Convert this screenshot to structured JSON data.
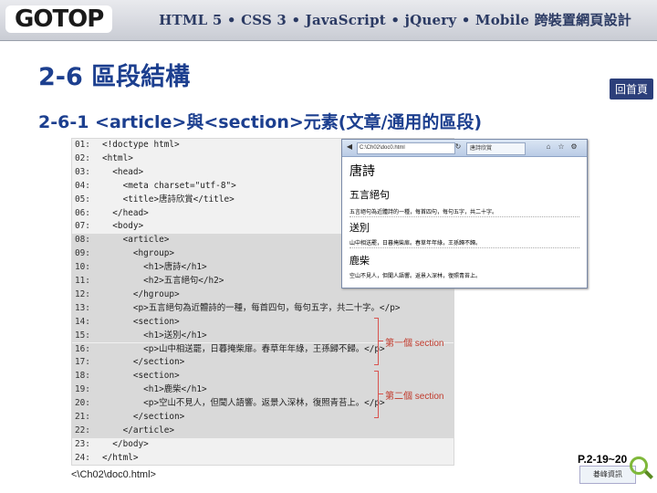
{
  "header": {
    "logo": "GOTOP",
    "title": "HTML 5 • CSS 3 • JavaScript • jQuery • Mobile 跨裝置網頁設計"
  },
  "page_title": "2-6  區段結構",
  "home_button": "回首頁",
  "subtitle": "2-6-1 <article>與<section>元素(文章/通用的區段)",
  "code_lines": [
    {
      "num": "01:",
      "code": "<!doctype html>"
    },
    {
      "num": "02:",
      "code": "<html>"
    },
    {
      "num": "03:",
      "code": "  <head>"
    },
    {
      "num": "04:",
      "code": "    <meta charset=\"utf-8\">"
    },
    {
      "num": "05:",
      "code": "    <title>唐詩欣賞</title>"
    },
    {
      "num": "06:",
      "code": "  </head>"
    },
    {
      "num": "07:",
      "code": "  <body>"
    },
    {
      "num": "08:",
      "code": "    <article>"
    },
    {
      "num": "09:",
      "code": "      <hgroup>"
    },
    {
      "num": "10:",
      "code": "        <h1>唐詩</h1>"
    },
    {
      "num": "11:",
      "code": "        <h2>五言絕句</h2>"
    },
    {
      "num": "12:",
      "code": "      </hgroup>"
    },
    {
      "num": "13:",
      "code": "      <p>五言絕句為近體詩的一種，每首四句，每句五字，共二十字。</p>"
    },
    {
      "num": "14:",
      "code": "      <section>"
    },
    {
      "num": "15:",
      "code": "        <h1>送別</h1>"
    },
    {
      "num": "16:",
      "code": "        <p>山中相送罷，日暮掩柴扉。春草年年綠，王孫歸不歸。</p>"
    },
    {
      "num": "17:",
      "code": "      </section>"
    },
    {
      "num": "18:",
      "code": "      <section>"
    },
    {
      "num": "19:",
      "code": "        <h1>鹿柴</h1>"
    },
    {
      "num": "20:",
      "code": "        <p>空山不見人，但聞人語響。返景入深林，復照青苔上。</p>"
    },
    {
      "num": "21:",
      "code": "      </section>"
    },
    {
      "num": "22:",
      "code": "    </article>"
    },
    {
      "num": "23:",
      "code": "  </body>"
    },
    {
      "num": "24:",
      "code": "</html>"
    }
  ],
  "annotations": {
    "section1": "第一個 section",
    "section2": "第二個 section"
  },
  "browser": {
    "url": "C:\\Ch02\\doc0.html",
    "tab": "唐詩欣賞",
    "content": {
      "h1": "唐詩",
      "h2": "五言絕句",
      "p1": "五言絕句為近體詩的一種，每首四句，每句五字，共二十字。",
      "s1_title": "送別",
      "s1_text": "山中相送罷，日暮掩柴扉。春草年年綠，王孫歸不歸。",
      "s2_title": "鹿柴",
      "s2_text": "空山不見人，但聞人語響。返景入深林，復照青苔上。"
    }
  },
  "file_name": "<\\Ch02\\doc0.html>",
  "page_ref": "P.2-19~20",
  "mini_logo": "碁峰資訊"
}
